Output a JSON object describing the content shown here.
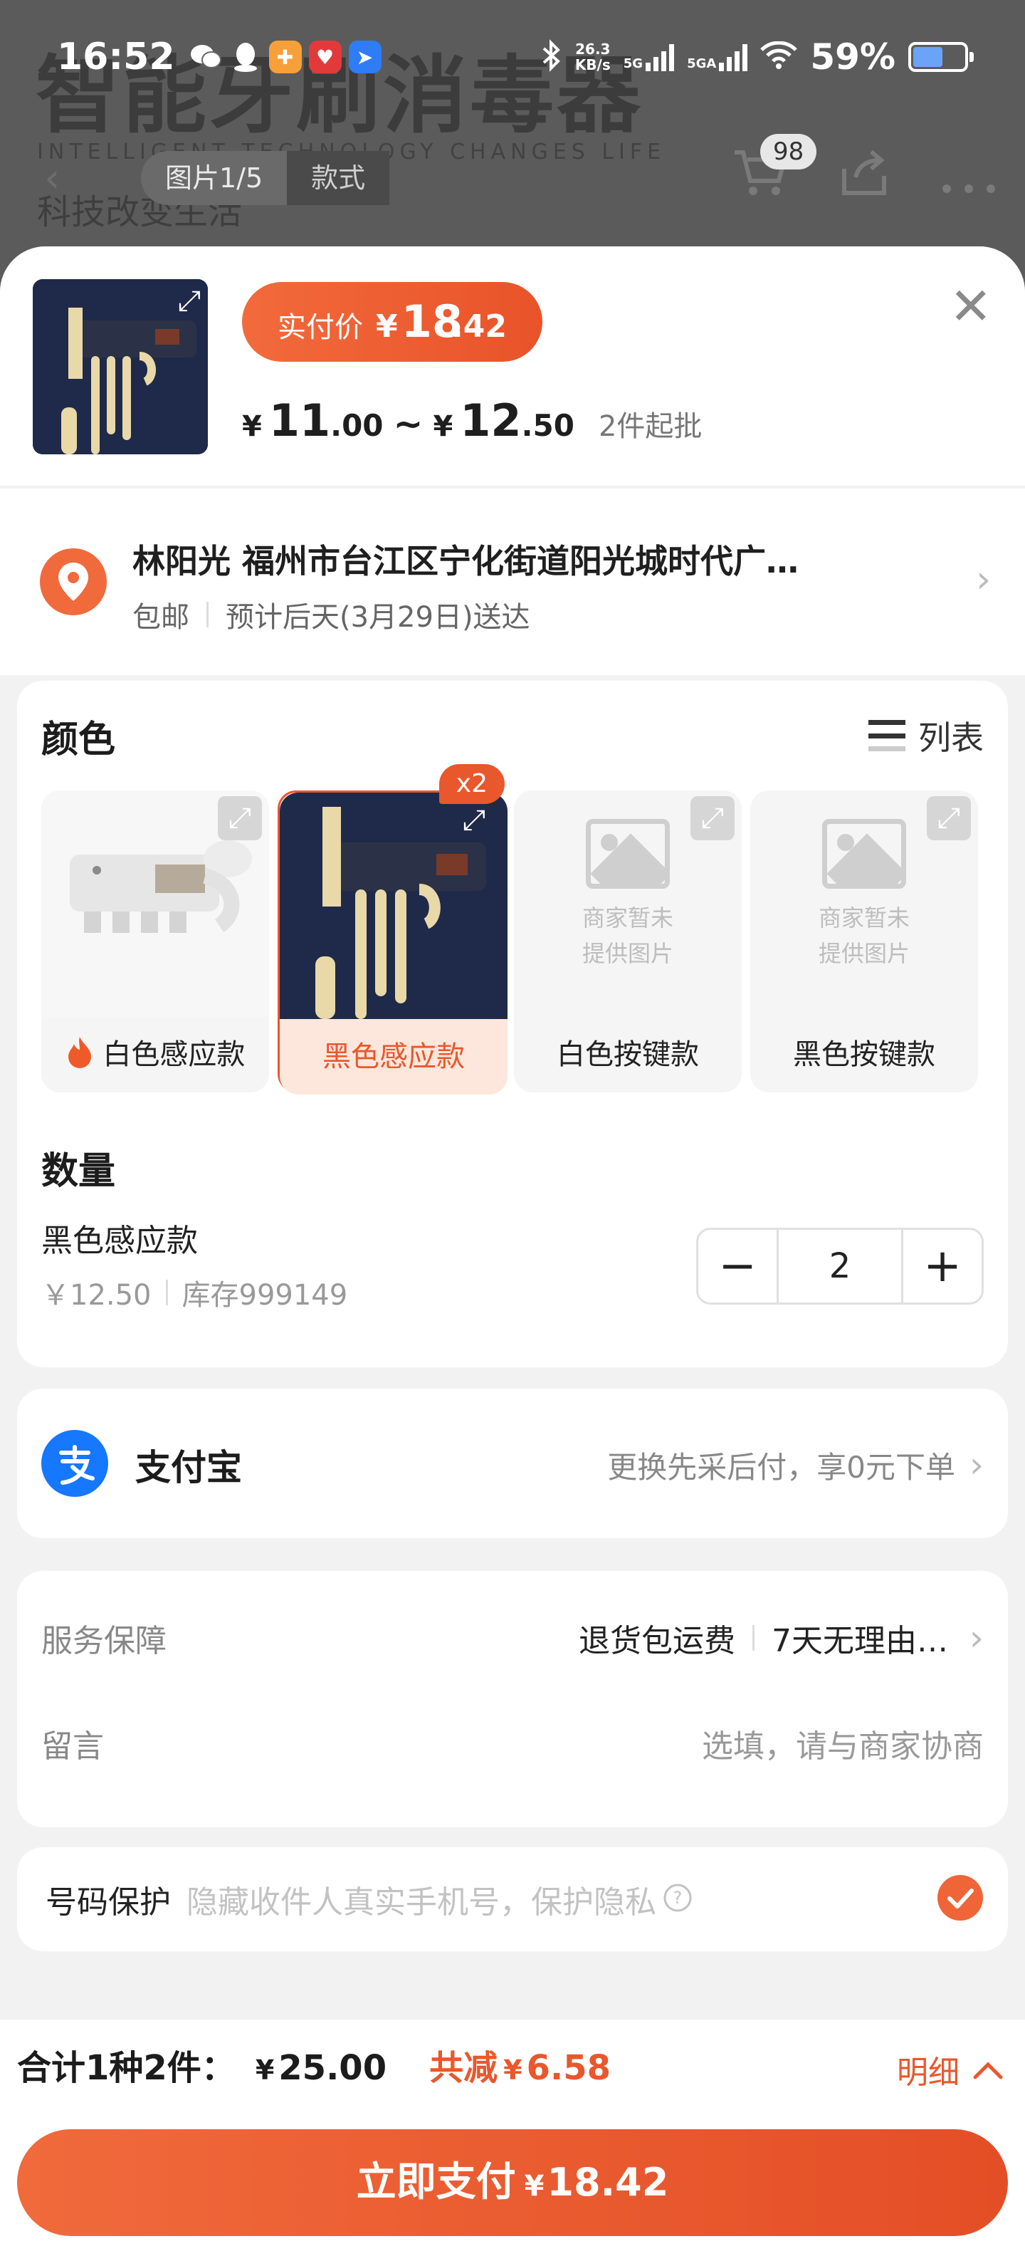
{
  "background_page": {
    "title": "智能牙刷消毒器",
    "subtitle_en": "INTELLIGENT TECHNOLOGY CHANGES LIFE",
    "subtitle_cn": "科技改变生活",
    "image_counter": "图片1/5",
    "style_tab": "款式",
    "cart_count": "98"
  },
  "status_bar": {
    "time": "16:52",
    "net_speed_value": "26.3",
    "net_speed_unit": "KB/s",
    "sig1": "5G",
    "sig2": "5GA",
    "battery": "59%",
    "battery_level": 0.59,
    "app_icons": [
      "wechat-icon",
      "qq-icon",
      "app-orange-icon",
      "app-red-icon",
      "app-blue-icon"
    ]
  },
  "sheet": {
    "price_label": "实付价",
    "price_yen": "¥",
    "price_int": "18",
    "price_dec": ".42",
    "range_low_int": "11",
    "range_low_dec": ".00",
    "range_tilde": "~",
    "range_high_int": "12",
    "range_high_dec": ".50",
    "min_order": "2件起批"
  },
  "address": {
    "name_line": "林阳光 福州市台江区宁化街道阳光城时代广…",
    "shipping": "包邮",
    "delivery": "预计后天(3月29日)送达"
  },
  "color": {
    "title": "颜色",
    "list_toggle": "列表",
    "options": [
      {
        "label": "白色感应款",
        "hot": true
      },
      {
        "label": "黑色感应款",
        "selected": true,
        "badge": "x2"
      },
      {
        "label": "白色按键款",
        "placeholder": "商家暂未\n提供图片"
      },
      {
        "label": "黑色按键款",
        "placeholder": "商家暂未\n提供图片"
      }
    ]
  },
  "quantity": {
    "title": "数量",
    "item_name": "黑色感应款",
    "unit_price": "￥12.50",
    "stock": "库存999149",
    "minus": "−",
    "value": "2",
    "plus": "+"
  },
  "payment": {
    "method": "支付宝",
    "hint": "更换先采后付，享0元下单"
  },
  "services": {
    "label": "服务保障",
    "value1": "退货包运费",
    "value2": "7天无理由…",
    "message_label": "留言",
    "message_placeholder": "选填，请与商家协商"
  },
  "privacy": {
    "label": "号码保护",
    "hint": "隐藏收件人真实手机号，保护隐私",
    "checked": true
  },
  "footer": {
    "total_label": "合计1种2件：",
    "total_yen": "¥",
    "total_amount": "25.00",
    "discount_label": "共减",
    "discount_yen": "¥",
    "discount_amount": "6.58",
    "detail": "明细",
    "pay_label": "立即支付",
    "pay_yen": "¥",
    "pay_amount": "18.42"
  },
  "colors": {
    "accent": "#e9572c",
    "alipay_blue": "#1677ff"
  }
}
